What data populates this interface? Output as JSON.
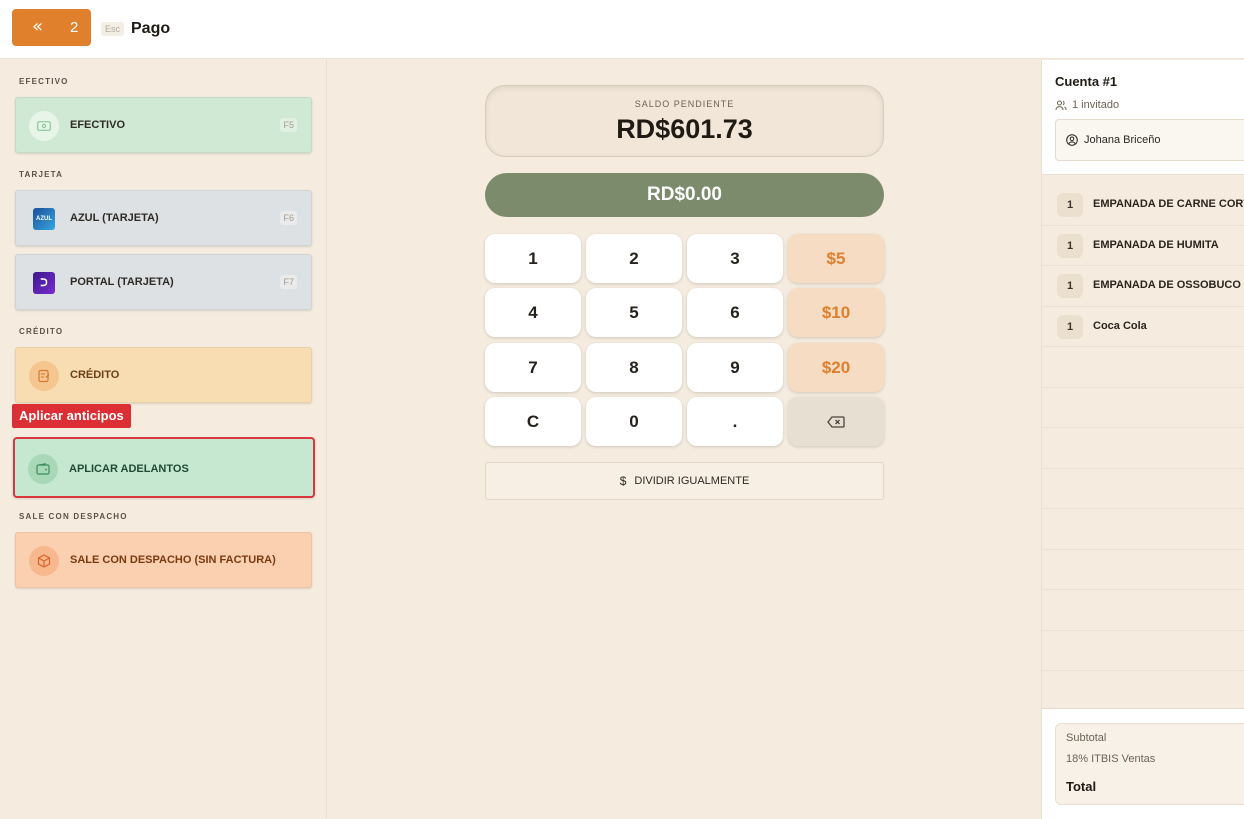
{
  "header": {
    "back_icon": "double-chevron-left",
    "back_count": "2",
    "esc_label": "Esc",
    "title": "Pago",
    "accent_color": "#e07f2c"
  },
  "payment_methods": {
    "sections": [
      {
        "label": "EFECTIVO"
      },
      {
        "label": "TARJETA"
      },
      {
        "label": "CRÉDITO"
      },
      {
        "label": "SALE CON DESPACHO"
      }
    ],
    "efectivo": {
      "label": "EFECTIVO",
      "shortcut": "F5",
      "icon": "cash-icon"
    },
    "azul": {
      "label": "AZUL (TARJETA)",
      "shortcut": "F6",
      "icon": "azul-logo",
      "logo_text": "AZUL"
    },
    "portal": {
      "label": "PORTAL (TARJETA)",
      "shortcut": "F7",
      "icon": "portal-logo",
      "logo_text": "ᑐ"
    },
    "credito": {
      "label": "CRÉDITO",
      "icon": "credit-note-icon"
    },
    "adelantos": {
      "label": "APLICAR ADELANTOS",
      "icon": "wallet-icon",
      "tooltip": "Aplicar anticipos"
    },
    "despacho": {
      "label": "SALE CON DESPACHO (SIN FACTURA)",
      "icon": "package-icon"
    }
  },
  "center": {
    "balance_caption": "SALDO PENDIENTE",
    "balance_amount": "RD$601.73",
    "paid_amount": "RD$0.00",
    "keypad": {
      "k1": "1",
      "k2": "2",
      "k3": "3",
      "k4": "4",
      "k5": "5",
      "k6": "6",
      "k7": "7",
      "k8": "8",
      "k9": "9",
      "kc": "C",
      "k0": "0",
      "kdot": ".",
      "q5": "$5",
      "q10": "$10",
      "q20": "$20"
    },
    "split_icon": "$",
    "split_label": "DIVIDIR IGUALMENTE"
  },
  "account": {
    "title": "Cuenta #1",
    "guests": "1 invitado",
    "client": "Johana Briceño",
    "items": [
      {
        "qty": "1",
        "name": "EMPANADA DE CARNE CORT"
      },
      {
        "qty": "1",
        "name": "EMPANADA DE HUMITA"
      },
      {
        "qty": "1",
        "name": "EMPANADA DE OSSOBUCO"
      },
      {
        "qty": "1",
        "name": "Coca Cola"
      }
    ],
    "subtotal_label": "Subtotal",
    "tax_label": "18% ITBIS Ventas",
    "total_label": "Total"
  }
}
